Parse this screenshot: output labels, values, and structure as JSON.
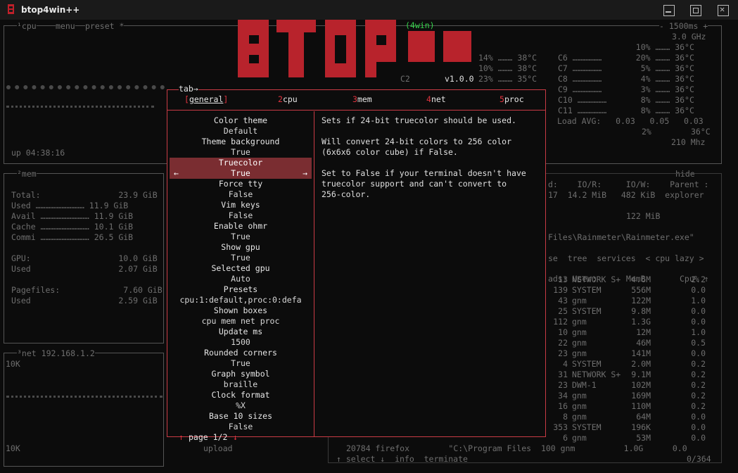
{
  "window": {
    "title": "btop4win++"
  },
  "logo": {
    "suffix": "(4win)",
    "version": "v1.0.0"
  },
  "cpu_box": {
    "tabs": [
      "¹cpu",
      "menu",
      "preset *"
    ],
    "refresh": "- 1500ms +",
    "freq_top": "3.0 GHz",
    "freq_bottom": "210 Mhz",
    "uptime": "up 04:38:16",
    "cores": [
      {
        "label": "",
        "pct": "10%",
        "temp": "36°C"
      },
      {
        "label": "C6",
        "pct": "20%",
        "temp": "36°C"
      },
      {
        "label": "C7",
        "pct": "5%",
        "temp": "36°C"
      },
      {
        "label": "C8",
        "pct": "4%",
        "temp": "36°C"
      },
      {
        "label": "C9",
        "pct": "3%",
        "temp": "36°C"
      },
      {
        "label": "C10",
        "pct": "8%",
        "temp": "36°C"
      },
      {
        "label": "C11",
        "pct": "8%",
        "temp": "36°C"
      }
    ],
    "left_cores": [
      {
        "pct": "14%",
        "temp": "38°C"
      },
      {
        "pct": "10%",
        "temp": "38°C"
      },
      {
        "pct": "23%",
        "temp": "35°C"
      }
    ],
    "c2_label": "C2",
    "load_avg": "Load AVG:   0.03   0.05   0.03",
    "total_pct": "2%",
    "total_temp": "36°C"
  },
  "mem_box": {
    "title": "²mem",
    "rows": [
      {
        "label": "Total:",
        "value": "23.9 GiB"
      },
      {
        "label": "Used",
        "value": "11.9 GiB"
      },
      {
        "label": "Avail",
        "value": "11.9 GiB"
      },
      {
        "label": "Cache",
        "value": "10.1 GiB"
      },
      {
        "label": "Commi",
        "value": "26.5 GiB"
      }
    ],
    "gpu_rows": [
      {
        "label": "GPU:",
        "value": "10.0 GiB"
      },
      {
        "label": "Used",
        "value": "2.07 GiB"
      }
    ],
    "page_rows": [
      {
        "label": "Pagefiles:",
        "value": "7.60 GiB"
      },
      {
        "label": "Used",
        "value": "2.59 GiB"
      }
    ]
  },
  "net_box": {
    "title": "³net",
    "ip": "192.168.1.2",
    "top_scale": "10K",
    "bottom_scale": "10K",
    "upload_label": "upload"
  },
  "disk_info": {
    "hide": "hide",
    "header": "d:    IO/R:     IO/W:    Parent :",
    "row": "17  14.2 MiB   482 KiB  explorer",
    "mem_line": "122 MiB",
    "path": "Files\\Rainmeter\\Rainmeter.exe\""
  },
  "proc_box": {
    "tabs_line": "se  tree  services  < cpu lazy >",
    "headers": {
      "threads": "ads:",
      "user": "User:",
      "mem": "MemB",
      "cpu": "Cpu%"
    },
    "rows": [
      {
        "threads": "13",
        "user": "NETWORK S+",
        "mem": "4.6M",
        "cpu": "2.2"
      },
      {
        "threads": "139",
        "user": "SYSTEM",
        "mem": "556M",
        "cpu": "0.0"
      },
      {
        "threads": "43",
        "user": "gnm",
        "mem": "122M",
        "cpu": "1.0"
      },
      {
        "threads": "25",
        "user": "SYSTEM",
        "mem": "9.8M",
        "cpu": "0.0"
      },
      {
        "threads": "112",
        "user": "gnm",
        "mem": "1.3G",
        "cpu": "0.0"
      },
      {
        "threads": "10",
        "user": "gnm",
        "mem": "12M",
        "cpu": "1.0"
      },
      {
        "threads": "22",
        "user": "gnm",
        "mem": "46M",
        "cpu": "0.5"
      },
      {
        "threads": "23",
        "user": "gnm",
        "mem": "141M",
        "cpu": "0.0"
      },
      {
        "threads": "4",
        "user": "SYSTEM",
        "mem": "2.0M",
        "cpu": "0.2"
      },
      {
        "threads": "31",
        "user": "NETWORK S+",
        "mem": "9.1M",
        "cpu": "0.2"
      },
      {
        "threads": "23",
        "user": "DWM-1",
        "mem": "102M",
        "cpu": "0.2"
      },
      {
        "threads": "34",
        "user": "gnm",
        "mem": "169M",
        "cpu": "0.2"
      },
      {
        "threads": "16",
        "user": "gnm",
        "mem": "110M",
        "cpu": "0.2"
      },
      {
        "threads": "8",
        "user": "gnm",
        "mem": "64M",
        "cpu": "0.0"
      },
      {
        "threads": "353",
        "user": "SYSTEM",
        "mem": "196K",
        "cpu": "0.0"
      },
      {
        "threads": "6",
        "user": "gnm",
        "mem": "53M",
        "cpu": "0.0"
      }
    ],
    "last_row": "20784 firefox        \"C:\\Program Files  100 gnm          1.0G      0.0",
    "footer": "↑ select ↓  info  terminate",
    "count": "0/364"
  },
  "menu": {
    "tab_hint": "tab→",
    "tabs": [
      {
        "num": "1",
        "label": "general",
        "active": true
      },
      {
        "num": "2",
        "label": "cpu",
        "active": false
      },
      {
        "num": "3",
        "label": "mem",
        "active": false
      },
      {
        "num": "4",
        "label": "net",
        "active": false
      },
      {
        "num": "5",
        "label": "proc",
        "active": false
      }
    ],
    "options": [
      {
        "name": "Color theme",
        "value": "Default"
      },
      {
        "name": "Theme background",
        "value": "True"
      },
      {
        "name": "Truecolor",
        "value": "True"
      },
      {
        "name": "Force tty",
        "value": "False"
      },
      {
        "name": "Vim keys",
        "value": "False"
      },
      {
        "name": "Enable ohmr",
        "value": "True"
      },
      {
        "name": "Show gpu",
        "value": "True"
      },
      {
        "name": "Selected gpu",
        "value": "Auto"
      },
      {
        "name": "Presets",
        "value": "cpu:1:default,proc:0:defa"
      },
      {
        "name": "Shown boxes",
        "value": "cpu mem net proc"
      },
      {
        "name": "Update ms",
        "value": "1500"
      },
      {
        "name": "Rounded corners",
        "value": "True"
      },
      {
        "name": "Graph symbol",
        "value": "braille"
      },
      {
        "name": "Clock format",
        "value": "%X"
      },
      {
        "name": "Base 10 sizes",
        "value": "False"
      }
    ],
    "selected_index": 2,
    "description": [
      "Sets if 24-bit truecolor should be used.",
      "",
      "Will convert 24-bit colors to 256 color",
      "(6x6x6 color cube) if False.",
      "",
      "Set to False if your terminal doesn't have",
      "truecolor support and can't convert to",
      "256-color."
    ],
    "page": "page 1/2",
    "page_up": "↑",
    "page_down": "↓",
    "arrow_left": "←",
    "arrow_right": "→"
  },
  "colors": {
    "accent": "#c93b45",
    "selected_bg": "#7a2d31",
    "logo": "#b8232c",
    "green": "#34d44a"
  }
}
